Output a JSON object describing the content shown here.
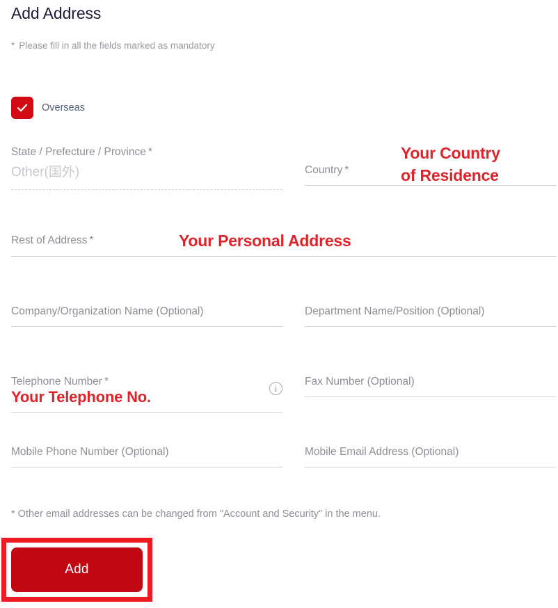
{
  "header": {
    "title": "Add Address",
    "mandatory_asterisk": "*",
    "mandatory_note": "Please fill in all the fields marked as mandatory"
  },
  "overseas_checkbox": {
    "label": "Overseas",
    "checked": true,
    "box_color": "#d20a14",
    "check_color": "#ffffff"
  },
  "fields": {
    "state": {
      "label": "State / Prefecture / Province",
      "required_marker": "*",
      "value": "Other(国外)",
      "underline_style": "dashed",
      "disabled": true
    },
    "country": {
      "label": "Country",
      "required_marker": "*",
      "value": "",
      "underline_style": "solid"
    },
    "rest_of_address": {
      "label": "Rest of Address",
      "required_marker": "*",
      "value": "",
      "underline_style": "solid"
    },
    "company": {
      "label": "Company/Organization Name (Optional)",
      "value": "",
      "underline_style": "solid"
    },
    "department": {
      "label": "Department Name/Position (Optional)",
      "value": "",
      "underline_style": "solid"
    },
    "telephone": {
      "label": "Telephone Number",
      "required_marker": "*",
      "value": "",
      "underline_style": "solid",
      "info_icon": "info-icon",
      "info_icon_glyph": "i"
    },
    "fax": {
      "label": "Fax Number (Optional)",
      "value": "",
      "underline_style": "solid"
    },
    "mobile_phone": {
      "label": "Mobile Phone Number (Optional)",
      "value": "",
      "underline_style": "solid"
    },
    "mobile_email": {
      "label": "Mobile Email Address (Optional)",
      "value": "",
      "underline_style": "solid"
    }
  },
  "annotations": {
    "color": "#e0232a",
    "country": "Your Country\nof Residence",
    "address": "Your Personal Address",
    "telephone": "Your Telephone No.",
    "submit_highlight_color": "#ed1c24"
  },
  "footnote": "* Other email addresses can be changed from \"Account and Security\" in the menu.",
  "submit": {
    "label": "Add",
    "color": "#c10812"
  }
}
